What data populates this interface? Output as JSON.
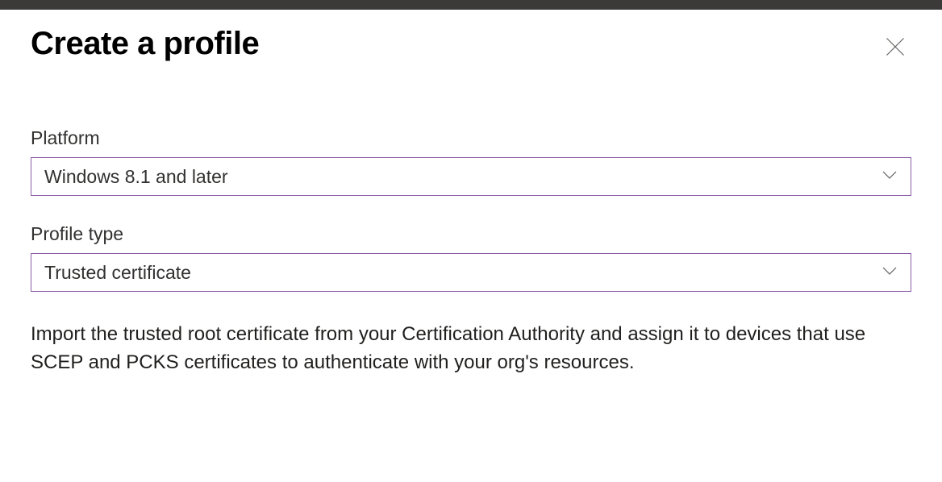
{
  "header": {
    "title": "Create a profile"
  },
  "form": {
    "platform": {
      "label": "Platform",
      "value": "Windows 8.1 and later"
    },
    "profileType": {
      "label": "Profile type",
      "value": "Trusted certificate"
    }
  },
  "description": "Import the trusted root certificate from your Certification Authority and assign it to devices that use SCEP and PCKS certificates to authenticate with your org's resources."
}
